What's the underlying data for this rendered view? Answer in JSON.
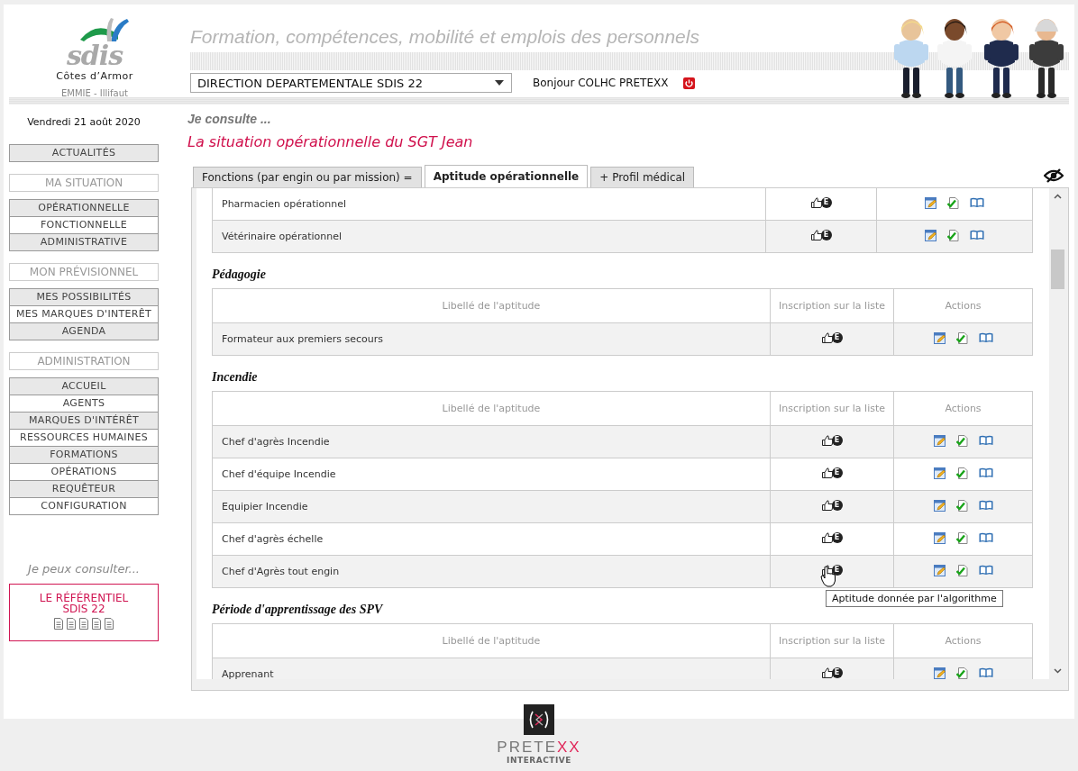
{
  "header": {
    "logo": {
      "brand": "sdis",
      "region": "Côtes d’Armor"
    },
    "app_name": "EMMIE - Illifaut",
    "tagline": "Formation, compétences, mobilité et emplois des personnels",
    "structure_select": {
      "value": "DIRECTION DEPARTEMENTALE SDIS 22"
    },
    "greeting": "Bonjour COLHC PRETEXX"
  },
  "sidebar": {
    "date": "Vendredi 21 août 2020",
    "groups": [
      {
        "items": [
          {
            "label": "ACTUALITÉS"
          }
        ]
      },
      {
        "heading": "MA SITUATION",
        "items": [
          {
            "label": "OPÉRATIONNELLE"
          },
          {
            "label": "FONCTIONNELLE"
          },
          {
            "label": "ADMINISTRATIVE"
          }
        ]
      },
      {
        "heading": "MON PRÉVISIONNEL",
        "items": [
          {
            "label": "MES POSSIBILITÉS"
          },
          {
            "label": "MES MARQUES D'INTERÊT"
          },
          {
            "label": "AGENDA"
          }
        ]
      },
      {
        "heading": "ADMINISTRATION",
        "items": [
          {
            "label": "ACCUEIL"
          },
          {
            "label": "AGENTS"
          },
          {
            "label": "MARQUES D'INTÉRÊT"
          },
          {
            "label": "RESSOURCES HUMAINES"
          },
          {
            "label": "FORMATIONS"
          },
          {
            "label": "OPÉRATIONS"
          },
          {
            "label": "REQUÊTEUR"
          },
          {
            "label": "CONFIGURATION"
          }
        ]
      }
    ],
    "consult": {
      "heading": "Je peux consulter...",
      "card": {
        "title": "LE RÉFÉRENTIEL SDIS 22"
      }
    }
  },
  "main": {
    "intro": "Je consulte ...",
    "subject": "La situation opérationnelle du SGT Jean",
    "tabs": [
      {
        "label": "Fonctions (par engin ou par mission) =",
        "selected": false
      },
      {
        "label": "Aptitude opérationnelle",
        "selected": true
      },
      {
        "label": "+ Profil médical",
        "selected": false
      }
    ],
    "sections": [
      {
        "rows": [
          {
            "label": "Pharmacien opérationnel",
            "badge": "E"
          },
          {
            "label": "Vétérinaire opérationnel",
            "badge": "E"
          }
        ]
      },
      {
        "title": "Pédagogie",
        "columns": [
          "Libellé de l'aptitude",
          "Inscription sur la liste",
          "Actions"
        ],
        "rows": [
          {
            "label": "Formateur aux premiers secours",
            "badge": "E"
          }
        ]
      },
      {
        "title": "Incendie",
        "columns": [
          "Libellé de l'aptitude",
          "Inscription sur la liste",
          "Actions"
        ],
        "rows": [
          {
            "label": "Chef d'agrès Incendie",
            "badge": "E"
          },
          {
            "label": "Chef d'équipe Incendie",
            "badge": "E"
          },
          {
            "label": "Equipier Incendie",
            "badge": "E"
          },
          {
            "label": "Chef d'agrès échelle",
            "badge": "E"
          },
          {
            "label": "Chef d'Agrès tout engin",
            "badge": "E",
            "tooltip": "Aptitude donnée par l'algorithme"
          }
        ]
      },
      {
        "title": "Période d'apprentissage des SPV",
        "columns": [
          "Libellé de l'aptitude",
          "Inscription sur la liste",
          "Actions"
        ],
        "rows": [
          {
            "label": "Apprenant",
            "badge": "E"
          }
        ]
      }
    ]
  },
  "footer": {
    "brand": [
      {
        "text": "PRETE",
        "accent": false
      },
      {
        "text": "XX",
        "accent": true
      }
    ],
    "tagline": "INTERACTIVE"
  }
}
